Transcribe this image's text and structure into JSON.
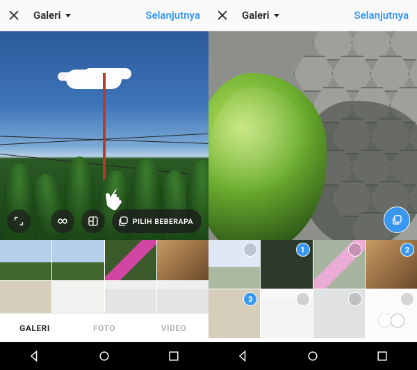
{
  "left": {
    "header": {
      "source": "Galeri",
      "next": "Selanjutnya"
    },
    "controls": {
      "multi_label": "PILIH BEBERAPA"
    },
    "tabs": {
      "gallery": "GALERI",
      "photo": "FOTO",
      "video": "VIDEO",
      "active": "gallery"
    }
  },
  "right": {
    "header": {
      "source": "Galeri",
      "next": "Selanjutnya"
    },
    "selection": {
      "thumb1": "",
      "thumb2": "1",
      "thumb3": "",
      "thumb4": "2",
      "thumb5": "3",
      "thumb6": "",
      "thumb7": "",
      "thumb8": ""
    }
  },
  "icons": {
    "close": "close-icon",
    "expand": "expand-icon",
    "boomerang": "infinity-icon",
    "combine": "layout-icon",
    "layers": "layers-icon",
    "pointer": "pointer-icon",
    "navBack": "nav-back-icon",
    "navHome": "nav-home-icon",
    "navRecent": "nav-recent-icon"
  }
}
